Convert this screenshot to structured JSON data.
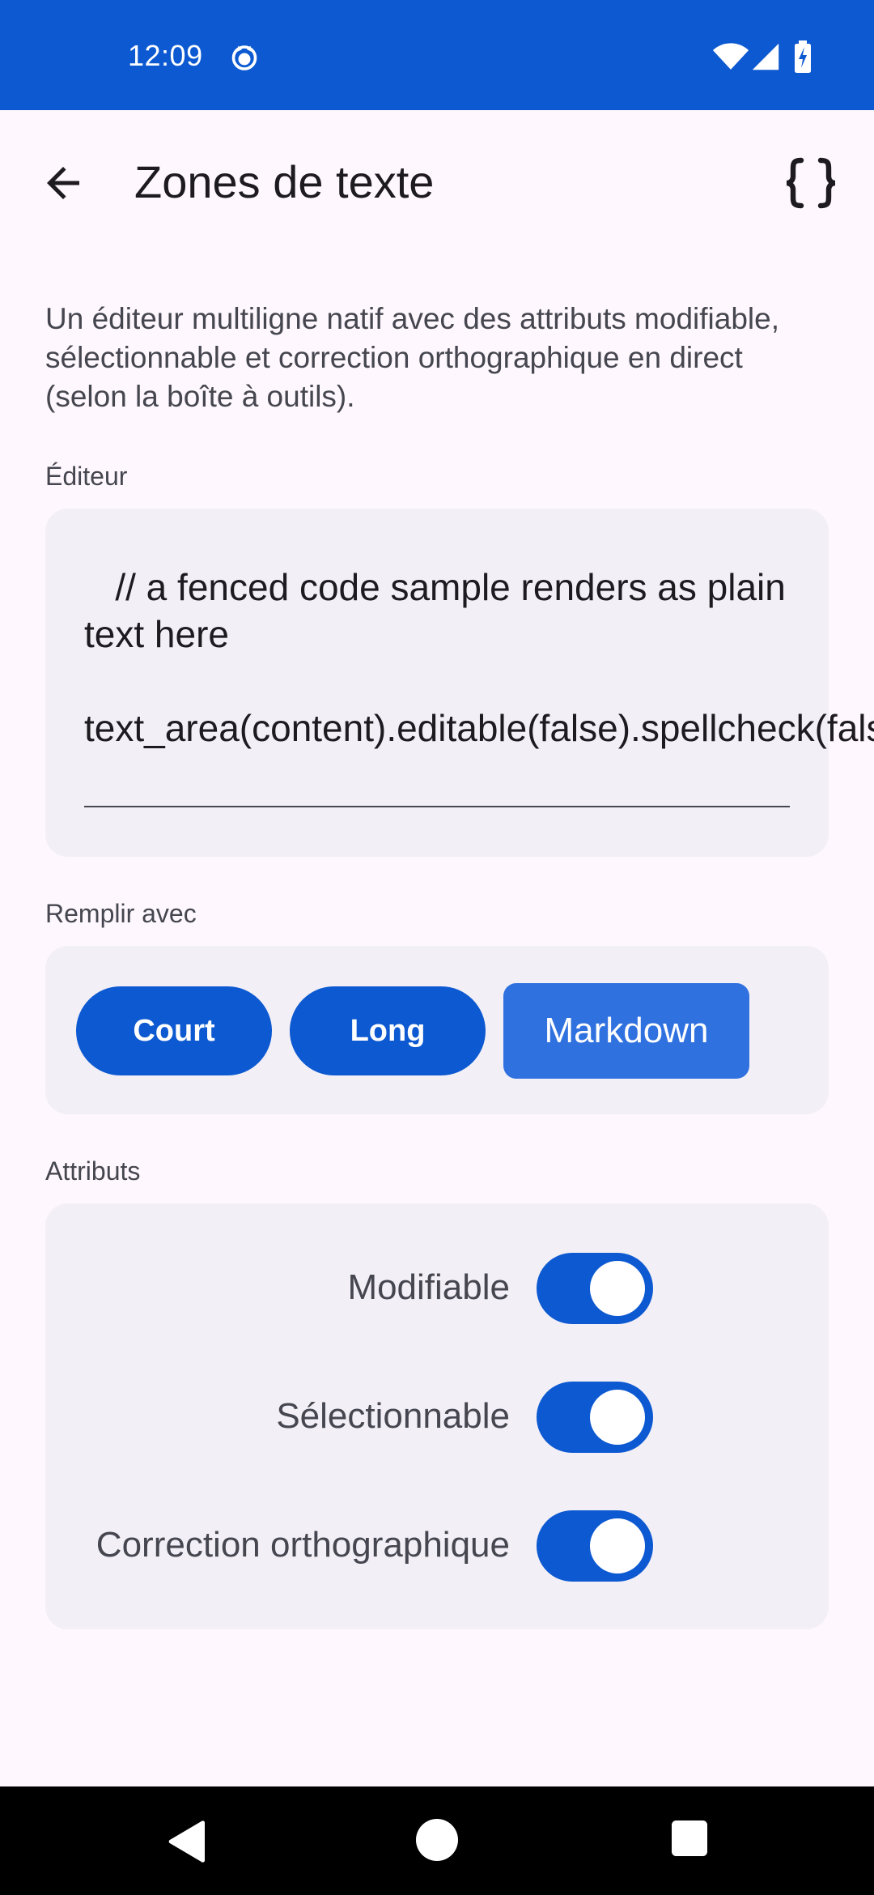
{
  "status_bar": {
    "time": "12:09",
    "icons": [
      "cat-notification-icon",
      "wifi-icon",
      "signal-icon",
      "battery-charging-icon"
    ]
  },
  "app_bar": {
    "title": "Zones de texte",
    "back_icon": "arrow-back-icon",
    "action_icon": "code-braces-icon"
  },
  "description": "Un éditeur multiligne natif avec des attributs modifiable, sélectionnable et correction orthographique en direct (selon la boîte à outils).",
  "editor": {
    "label": "Éditeur",
    "content": "   // a fenced code sample renders as plain text here\n\ntext_area(content).editable(false).spellcheck(false)"
  },
  "fill": {
    "label": "Remplir avec",
    "buttons": [
      {
        "label": "Court",
        "selected": false
      },
      {
        "label": "Long",
        "selected": false
      },
      {
        "label": "Markdown",
        "selected": true
      }
    ]
  },
  "attributes": {
    "label": "Attributs",
    "items": [
      {
        "label": "Modifiable",
        "on": true
      },
      {
        "label": "Sélectionnable",
        "on": true
      },
      {
        "label": "Correction orthographique",
        "on": true
      }
    ]
  },
  "colors": {
    "primary": "#0c59d1",
    "selected_button": "#3071e0",
    "background": "#fef7fd",
    "card": "#f2eff6"
  }
}
